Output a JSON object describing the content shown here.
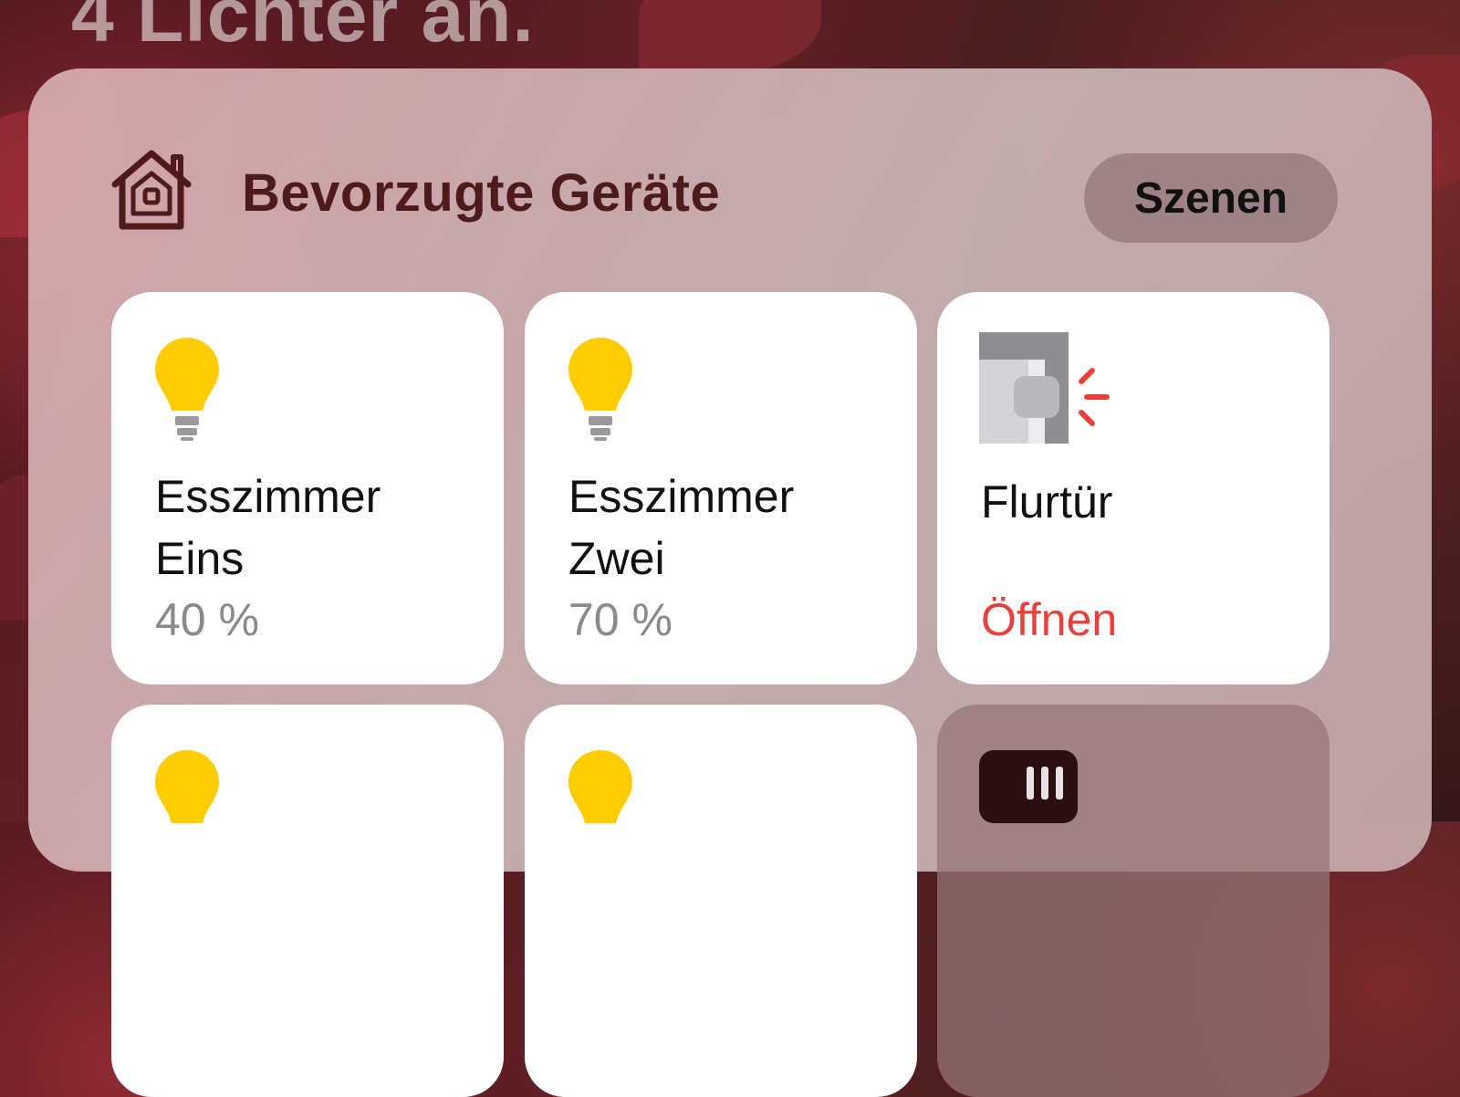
{
  "background_title": "4 Lichter an.",
  "header": {
    "title": "Bevorzugte Geräte",
    "home_icon": "home-icon",
    "scenes_label": "Szenen"
  },
  "tiles": [
    {
      "icon": "lightbulb-icon",
      "name_line1": "Esszimmer",
      "name_line2": "Eins",
      "status": "40 %"
    },
    {
      "icon": "lightbulb-icon",
      "name_line1": "Esszimmer",
      "name_line2": "Zwei",
      "status": "70 %"
    },
    {
      "icon": "door-open-icon",
      "name_line1": "Flurtür",
      "name_line2": "",
      "status": "Öffnen"
    },
    {
      "icon": "lightbulb-icon"
    },
    {
      "icon": "lightbulb-icon"
    },
    {
      "icon": "device-icon"
    }
  ],
  "colors": {
    "header_text": "#4e1a1b",
    "bulb_on": "#ffcc00",
    "status_alert": "#e8413b",
    "status_muted": "#8a8a8e"
  }
}
